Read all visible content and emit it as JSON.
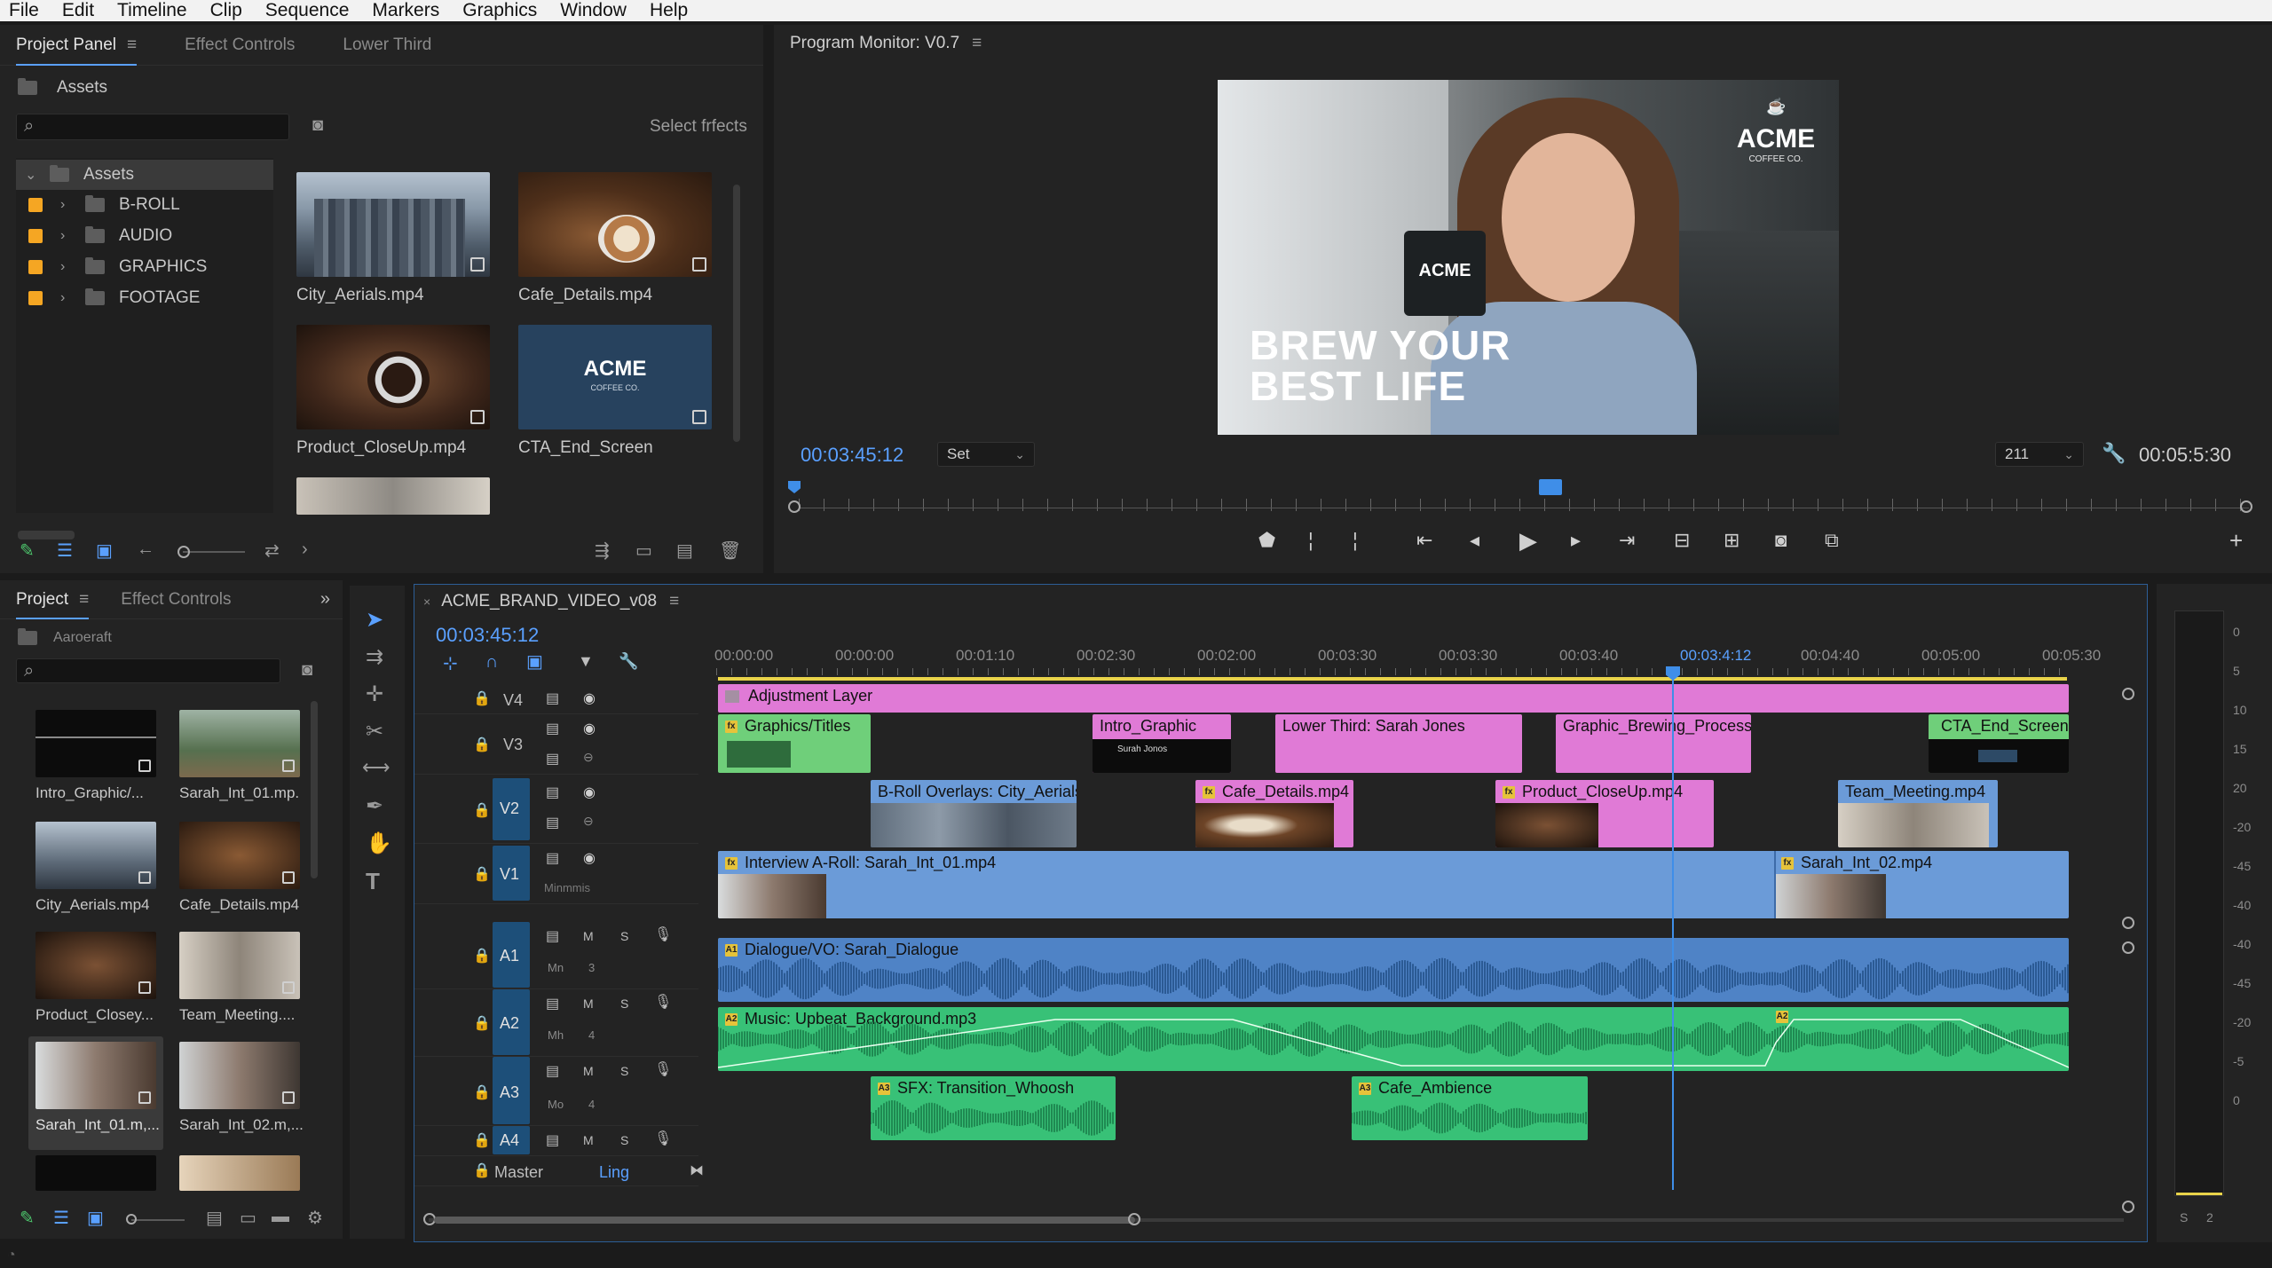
{
  "menu": [
    "File",
    "Edit",
    "Timeline",
    "Clip",
    "Sequence",
    "Markers",
    "Graphics",
    "Window",
    "Help"
  ],
  "project_panel": {
    "tabs": [
      "Project Panel",
      "Effect Controls",
      "Lower Third"
    ],
    "bin_label": "Assets",
    "select_effects": "Select frfects",
    "tree": {
      "root": "Assets",
      "items": [
        "B-ROLL",
        "AUDIO",
        "GRAPHICS",
        "FOOTAGE"
      ]
    },
    "thumbs": [
      "City_Aerials.mp4",
      "Cafe_Details.mp4",
      "Product_CloseUp.mp4",
      "CTA_End_Screen"
    ]
  },
  "project2": {
    "tabs": [
      "Project",
      "Effect Controls"
    ],
    "bin_label": "Aaroeraft",
    "thumbs": [
      "Intro_Graphic/...",
      "Sarah_Int_01.mp.",
      "City_Aerials.mp4",
      "Cafe_Details.mp4",
      "Product_Closey...",
      "Team_Meeting....",
      "Sarah_Int_01.m,...",
      "Sarah_Int_02.m,..."
    ]
  },
  "program_monitor": {
    "title": "Program Monitor: V0.7",
    "timecode": "00:03:45:12",
    "fit": "Set",
    "zoom": "211",
    "duration": "00:05:5:30",
    "overlay_line1": "BREW YOUR",
    "overlay_line2": "BEST LIFE",
    "logo_main": "ACME",
    "logo_sub": "COFFEE CO.",
    "mug_logo": "ACME"
  },
  "timeline": {
    "sequence": "ACME_BRAND_VIDEO_v08",
    "timecode": "00:03:45:12",
    "ruler": [
      "00:00:00",
      "00:00:00",
      "00:01:10",
      "00:02:30",
      "00:02:00",
      "00:03:30",
      "00:03:30",
      "00:03:40",
      "00:03:4:12",
      "00:04:40",
      "00:05:00",
      "00:05:30"
    ],
    "tracks": [
      {
        "name": "V4",
        "sub": ""
      },
      {
        "name": "V3",
        "sub": ""
      },
      {
        "name": "V2",
        "sub": ""
      },
      {
        "name": "V1",
        "sub": "Minmmis"
      },
      {
        "name": "A1",
        "sub": "Mn",
        "num": "3"
      },
      {
        "name": "A2",
        "sub": "Mh",
        "num": "4"
      },
      {
        "name": "A3",
        "sub": "Mo",
        "num": "4"
      },
      {
        "name": "A4",
        "sub": ""
      }
    ],
    "master": "Master",
    "master_link": "Ling",
    "clips": {
      "adjustment": "Adjustment Layer",
      "graphics_titles": "Graphics/Titles",
      "intro_graphic": "Intro_Graphic",
      "intro_sub": "Surah Jonos",
      "lower_third": "Lower Third: Sarah Jones",
      "brewing": "Graphic_Brewing_Process",
      "cta": "CTA_End_Screen",
      "broll": "B-Roll Overlays: City_Aerials.mp4",
      "cafe": "Cafe_Details.mp4",
      "product": "Product_CloseUp.mp4",
      "team": "Team_Meeting.mp4",
      "interview": "Interview A-Roll: Sarah_Int_01.mp4",
      "sarah2": "Sarah_Int_02.mp4",
      "dialogue": "Dialogue/VO: Sarah_Dialogue",
      "music": "Music: Upbeat_Background.mp3",
      "sfx": "SFX: Transition_Whoosh",
      "ambience": "Cafe_Ambience"
    }
  },
  "meter": [
    "0",
    "5",
    "10",
    "15",
    "20",
    "-20",
    "-45",
    "-40",
    "-40",
    "-45",
    "-20",
    "-5",
    "0"
  ],
  "meter_bottom": [
    "S",
    "2"
  ]
}
